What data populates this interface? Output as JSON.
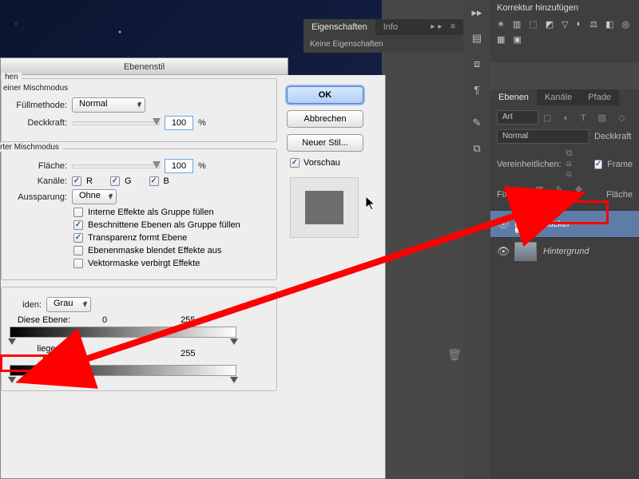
{
  "dialog": {
    "title": "Ebenenstil",
    "blendGroup": {
      "title": "hen",
      "subtitle": "einer Mischmodus",
      "fillLabel": "Füllmethode:",
      "fillSelect": "Normal",
      "opacityLabel": "Deckkraft:",
      "opacityValue": "100",
      "opacityUnit": "%"
    },
    "advGroup": {
      "subtitle": "rter Mischmodus",
      "areaLabel": "Fläche:",
      "areaValue": "100",
      "areaUnit": "%",
      "channelsLabel": "Kanäle:",
      "channelR": "R",
      "channelG": "G",
      "channelB": "B",
      "knockoutLabel": "Aussparung:",
      "knockoutSelect": "Ohne",
      "opt1": "Interne Effekte als Gruppe füllen",
      "opt2": "Beschnittene Ebenen als Gruppe füllen",
      "opt3": "Transparenz formt Ebene",
      "opt4": "Ebenenmaske blendet Effekte aus",
      "opt5": "Vektormaske verbirgt Effekte"
    },
    "blendIf": {
      "modeLabel": "iden:",
      "modeSelect": "Grau",
      "thisLabel": "Diese Ebene:",
      "thisMin": "0",
      "thisMax": "255",
      "underLabel": "liegende Ebene:",
      "underMin": "0",
      "underMax": "255"
    },
    "buttons": {
      "ok": "OK",
      "cancel": "Abbrechen",
      "newStyle": "Neuer Stil...",
      "preview": "Vorschau"
    }
  },
  "props": {
    "tab1": "Eigenschaften",
    "tab2": "Info",
    "text": "Keine Eigenschaften"
  },
  "corrections": {
    "title": "Korrektur hinzufügen"
  },
  "layers": {
    "tabLayers": "Ebenen",
    "tabChannels": "Kanäle",
    "tabPaths": "Pfade",
    "filterSelect": "Art",
    "blendSelect": "Normal",
    "opacityLabel": "Deckkraft",
    "unifyLabel": "Vereinheitlichen:",
    "frameLabel": "Frame",
    "lockLabel": "Fixieren:",
    "fillLabel": "Fläche",
    "layer1": "Zucker",
    "layer2": "Hintergrund"
  }
}
